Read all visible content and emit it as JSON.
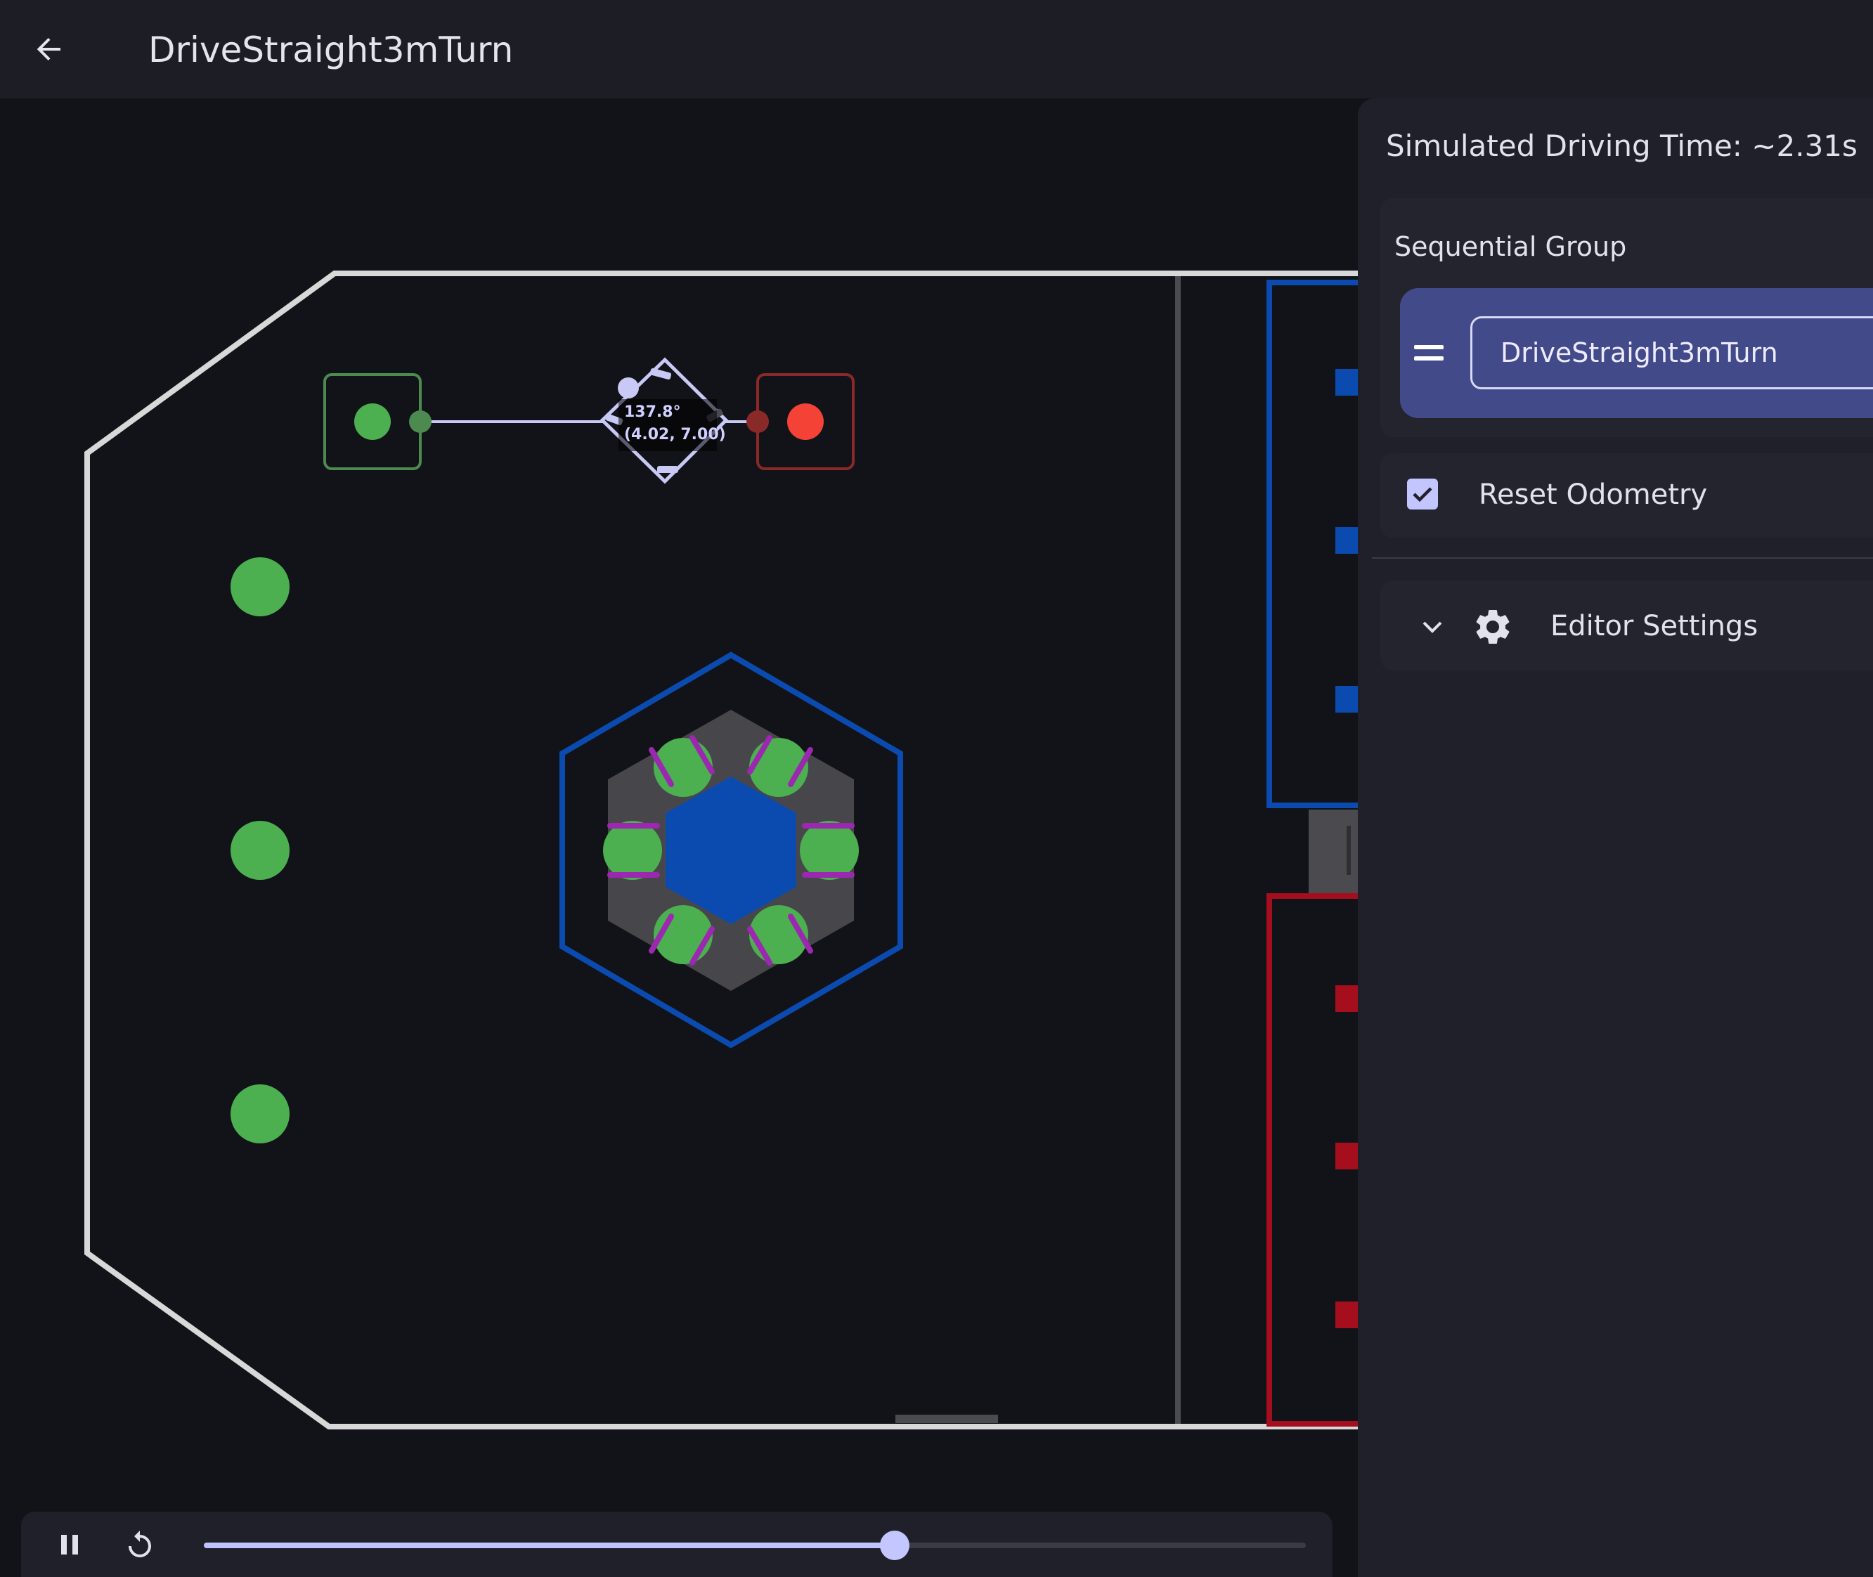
{
  "header": {
    "title": "DriveStraight3mTurn",
    "back_icon": "arrow-back-icon"
  },
  "field": {
    "waypoint_label_heading": "137.8°",
    "waypoint_label_position": "(4.02, 7.00)",
    "colors": {
      "start": "#4caf50",
      "end": "#f44336",
      "blue_alliance": "#0b4bb0",
      "red_alliance": "#a50e1c",
      "path": "#c8c9f4",
      "field_border": "#d8d8d8"
    }
  },
  "playback": {
    "pause_icon": "pause-icon",
    "restart_icon": "restart-icon",
    "progress": 0.627
  },
  "sidebar": {
    "sim_time": "Simulated Driving Time: ~2.31s",
    "group_title": "Sequential Group",
    "command_name": "DriveStraight3mTurn",
    "reset_odometry_label": "Reset Odometry",
    "reset_odometry_checked": true,
    "editor_settings_label": "Editor Settings"
  }
}
